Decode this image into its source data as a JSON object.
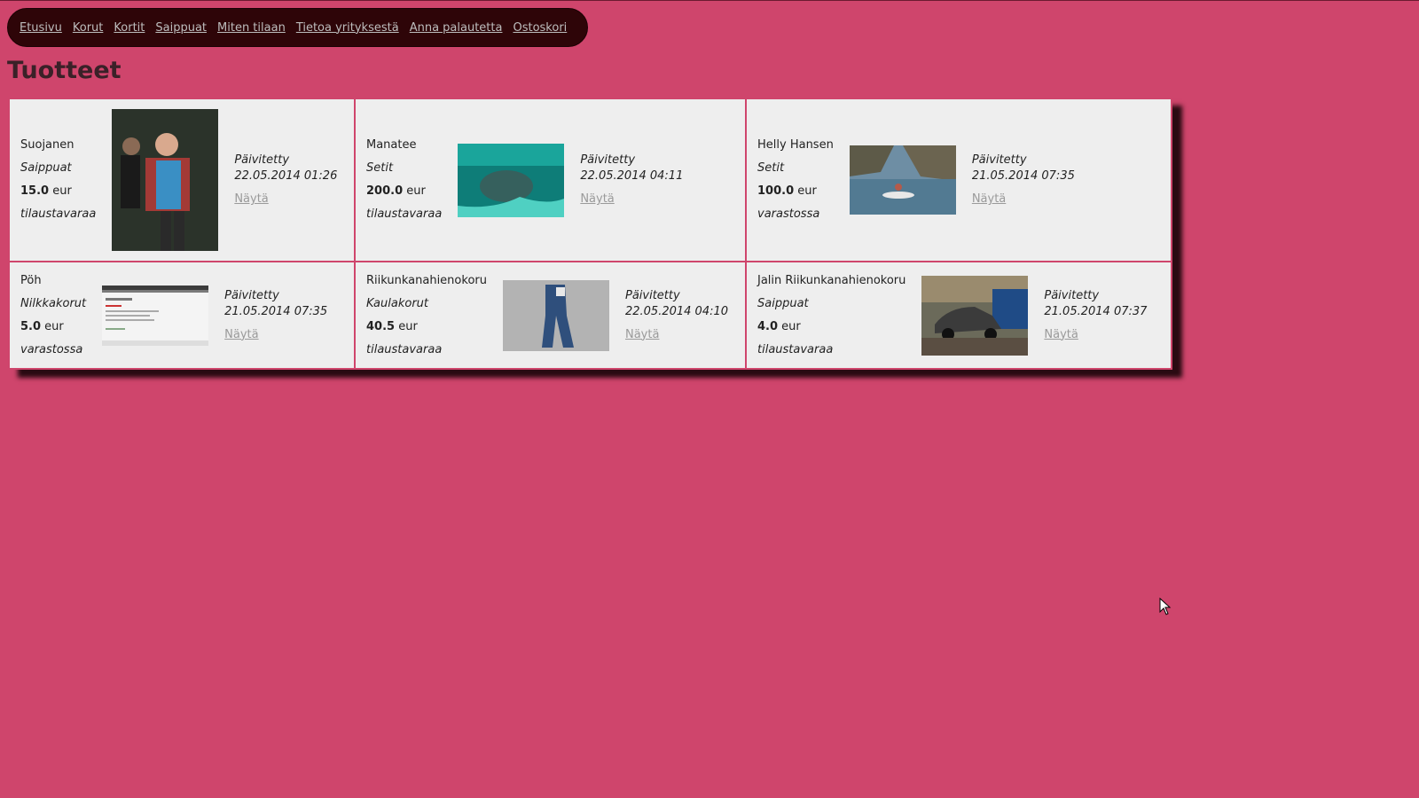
{
  "nav": [
    "Etusivu",
    "Korut",
    "Kortit",
    "Saippuat",
    "Miten tilaan",
    "Tietoa yrityksestä",
    "Anna palautetta",
    "Ostoskori"
  ],
  "page_title": "Tuotteet",
  "products": [
    {
      "name": "Suojanen",
      "category": "Saippuat",
      "price": "15.0",
      "currency": "eur",
      "status": "tilaustavaraa",
      "updated_label": "Päivitetty",
      "updated": "22.05.2014 01:26",
      "show_label": "Näytä"
    },
    {
      "name": "Manatee",
      "category": "Setit",
      "price": "200.0",
      "currency": "eur",
      "status": "tilaustavaraa",
      "updated_label": "Päivitetty",
      "updated": "22.05.2014 04:11",
      "show_label": "Näytä"
    },
    {
      "name": "Helly Hansen",
      "category": "Setit",
      "price": "100.0",
      "currency": "eur",
      "status": "varastossa",
      "updated_label": "Päivitetty",
      "updated": "21.05.2014 07:35",
      "show_label": "Näytä"
    },
    {
      "name": "Pöh",
      "category": "Nilkkakorut",
      "price": "5.0",
      "currency": "eur",
      "status": "varastossa",
      "updated_label": "Päivitetty",
      "updated": "21.05.2014 07:35",
      "show_label": "Näytä"
    },
    {
      "name": "Riikunkanahienokoru",
      "category": "Kaulakorut",
      "price": "40.5",
      "currency": "eur",
      "status": "tilaustavaraa",
      "updated_label": "Päivitetty",
      "updated": "22.05.2014 04:10",
      "show_label": "Näytä"
    },
    {
      "name": "Jalin Riikunkanahienokoru",
      "category": "Saippuat",
      "price": "4.0",
      "currency": "eur",
      "status": "tilaustavaraa",
      "updated_label": "Päivitetty",
      "updated": "21.05.2014 07:37",
      "show_label": "Näytä"
    }
  ],
  "colors": {
    "background": "#cf456c",
    "nav_bg": "#2e0508",
    "card_bg": "#eeeeee"
  }
}
